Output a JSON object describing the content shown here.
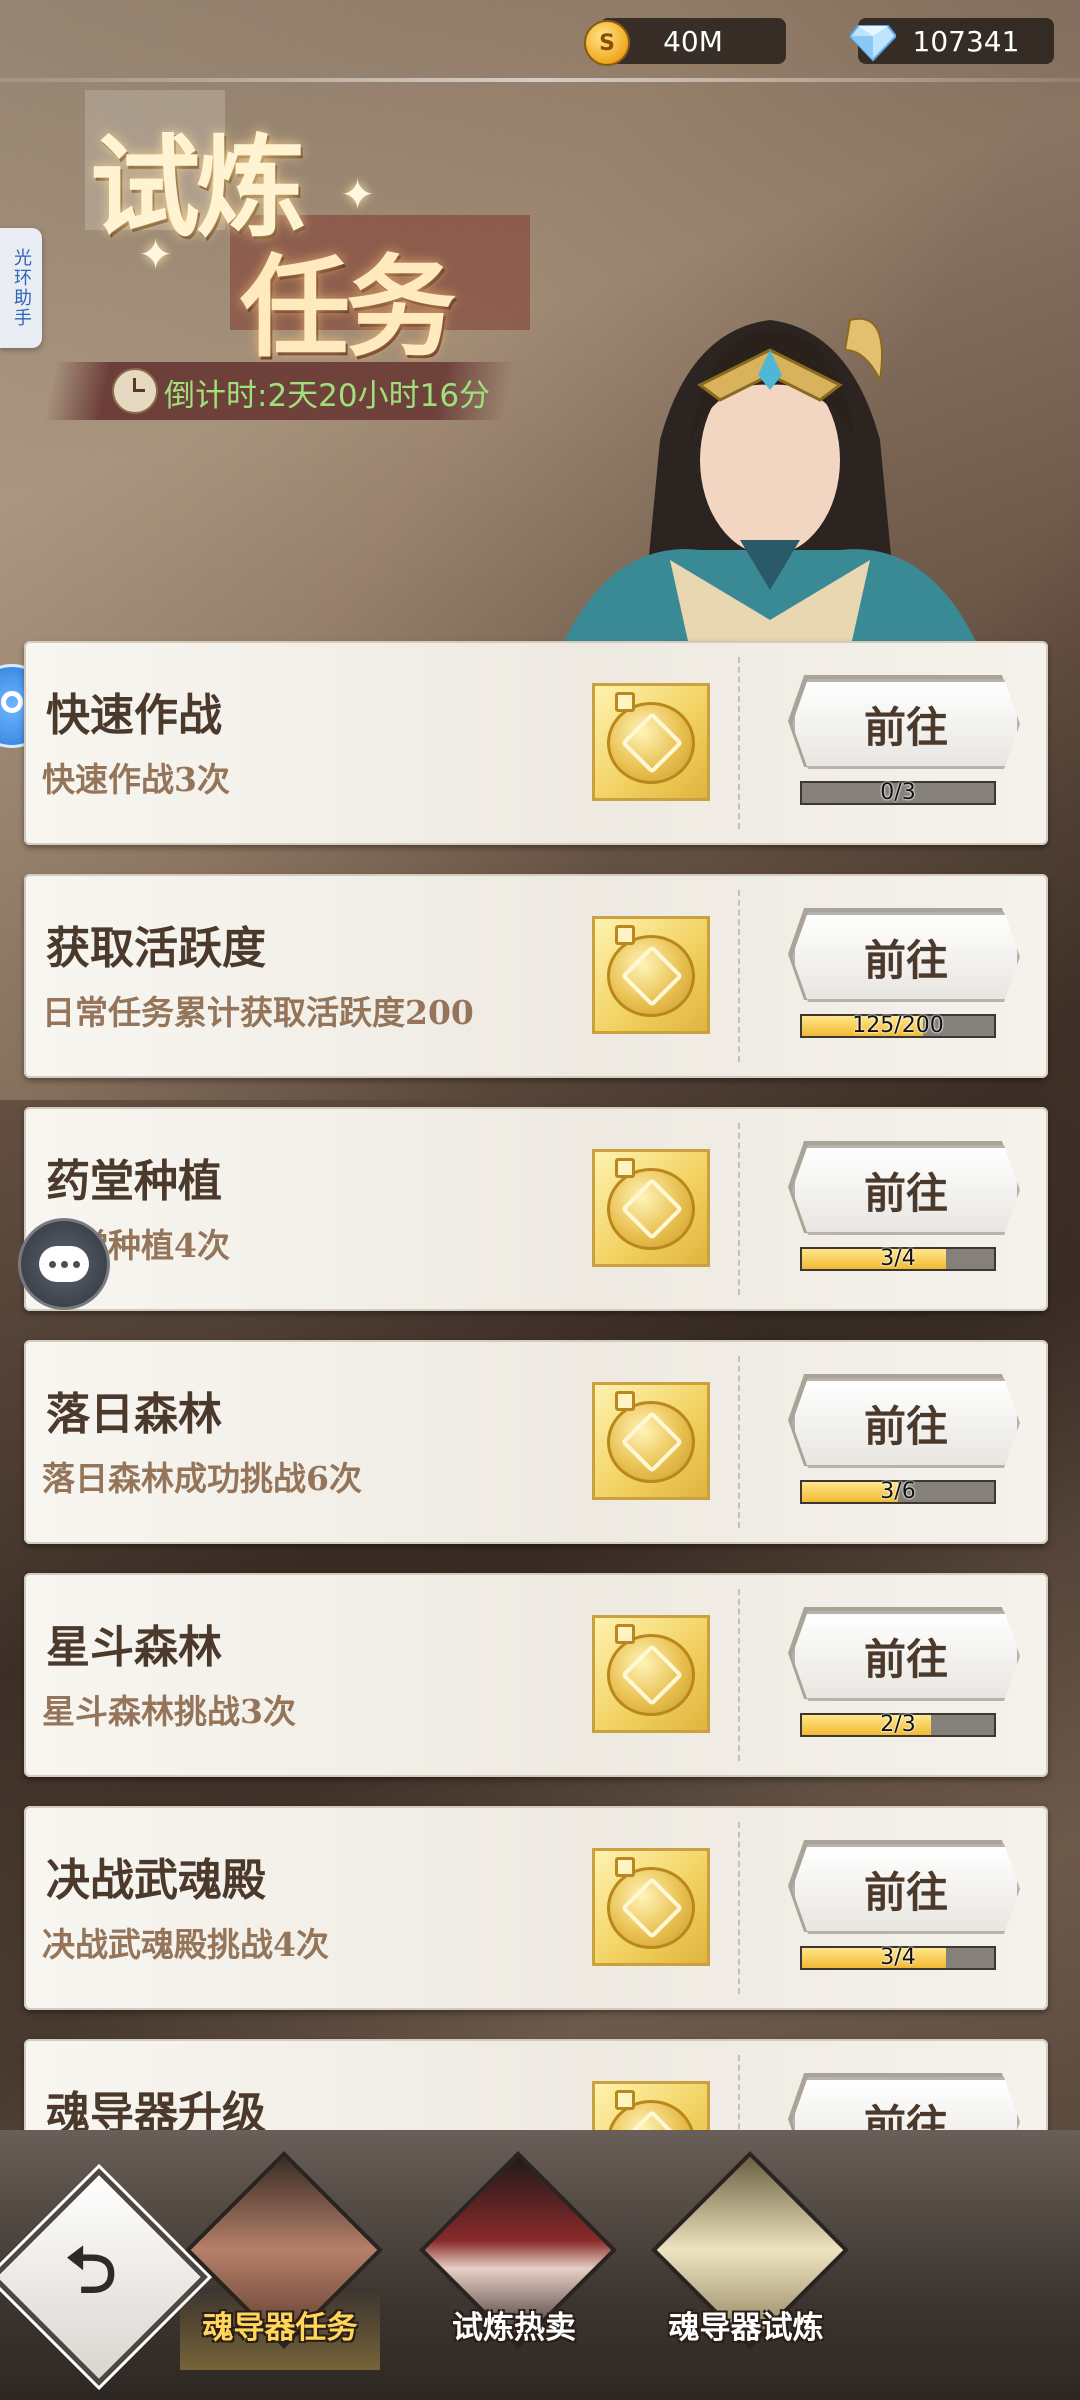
{
  "resources": {
    "coins": "40M",
    "gems": "107341"
  },
  "side": {
    "helper_label": "光环助手"
  },
  "header": {
    "title_line1": "试炼",
    "title_line2": "任务",
    "countdown": "倒计时:2天20小时16分"
  },
  "tasks": [
    {
      "name": "快速作战",
      "desc": "快速作战3次",
      "button": "前往",
      "progress_text": "0/3",
      "progress": 0.0
    },
    {
      "name": "获取活跃度",
      "desc": "日常任务累计获取活跃度200",
      "button": "前往",
      "progress_text": "125/200",
      "progress": 0.625
    },
    {
      "name": "药堂种植",
      "desc": "药堂种植4次",
      "button": "前往",
      "progress_text": "3/4",
      "progress": 0.75
    },
    {
      "name": "落日森林",
      "desc": "落日森林成功挑战6次",
      "button": "前往",
      "progress_text": "3/6",
      "progress": 0.5
    },
    {
      "name": "星斗森林",
      "desc": "星斗森林挑战3次",
      "button": "前往",
      "progress_text": "2/3",
      "progress": 0.6667
    },
    {
      "name": "决战武魂殿",
      "desc": "决战武魂殿挑战4次",
      "button": "前往",
      "progress_text": "3/4",
      "progress": 0.75
    },
    {
      "name": "魂导器升级",
      "desc": "",
      "button": "前往",
      "progress_text": "",
      "progress": 0.0
    }
  ],
  "tabs": [
    {
      "label": "魂导器任务",
      "active": true
    },
    {
      "label": "试炼热卖",
      "active": false
    },
    {
      "label": "魂导器试炼",
      "active": false
    }
  ],
  "colors": {
    "progress_fill": "#f1b934",
    "countdown_text": "#9fe07a",
    "active_tab_text": "#ffd65a"
  }
}
